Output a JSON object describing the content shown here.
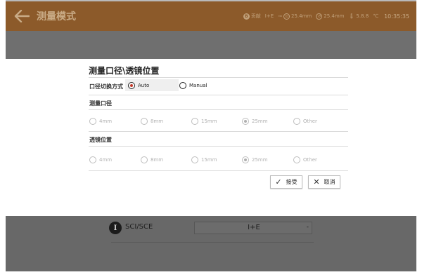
{
  "topbar": {
    "title": "测量模式",
    "status": {
      "mode_badge": "B",
      "mode_text": "贡献",
      "illuminant": "I+E",
      "port_text": "25.4mm",
      "lens_text": "25.4mm",
      "temp_text": "5.8.8",
      "temp_unit": "℃",
      "time": "10:35:35"
    }
  },
  "background": {
    "icon_letter": "I",
    "label": "SCI/SCE",
    "select_value": "I+E",
    "select_caret": "-"
  },
  "dialog": {
    "title": "测量口径\\透镜位置",
    "switch_mode": {
      "label": "口径切换方式",
      "options": [
        {
          "label": "Auto",
          "checked": true
        },
        {
          "label": "Manual",
          "checked": false
        }
      ]
    },
    "aperture": {
      "label": "测量口径",
      "options": [
        {
          "label": "4mm",
          "checked": false
        },
        {
          "label": "8mm",
          "checked": false
        },
        {
          "label": "15mm",
          "checked": false
        },
        {
          "label": "25mm",
          "checked": true
        },
        {
          "label": "Other",
          "checked": false
        }
      ]
    },
    "lens": {
      "label": "透镜位置",
      "options": [
        {
          "label": "4mm",
          "checked": false
        },
        {
          "label": "8mm",
          "checked": false
        },
        {
          "label": "15mm",
          "checked": false
        },
        {
          "label": "25mm",
          "checked": true
        },
        {
          "label": "Other",
          "checked": false
        }
      ]
    },
    "accept_label": "接受",
    "cancel_label": "取消"
  },
  "colors": {
    "topbar_bg": "#8c5a2a",
    "overlay_gray": "#6f6f6f",
    "accent_radio": "#c0392b"
  },
  "icons": {
    "back": "arrow-left-icon",
    "accept": "check-icon",
    "cancel": "close-icon"
  }
}
